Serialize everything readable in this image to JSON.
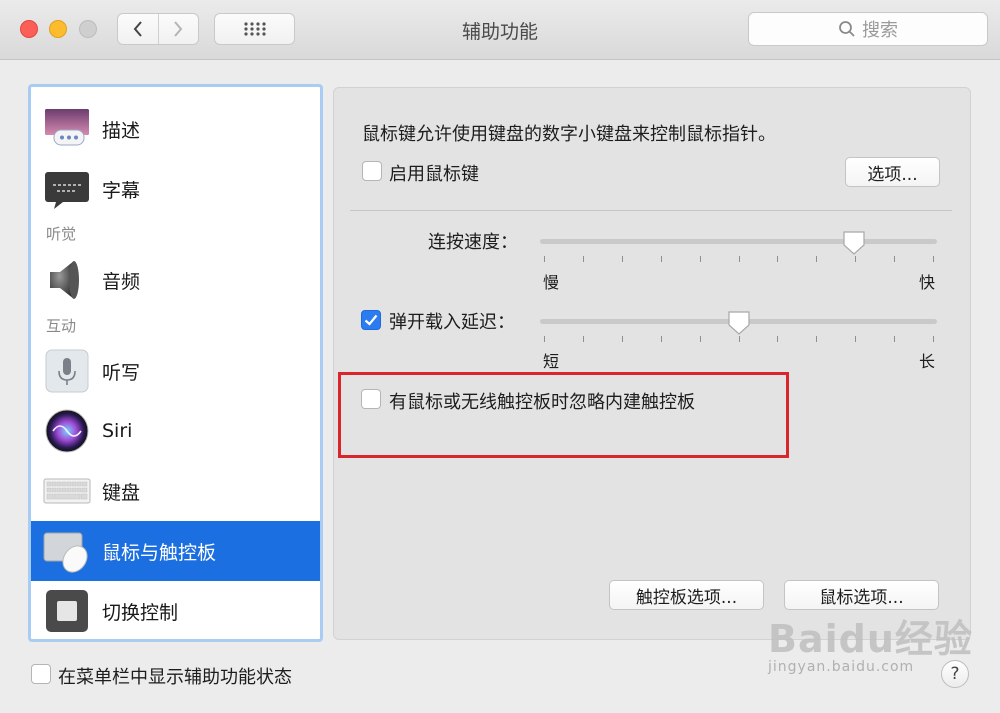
{
  "window": {
    "title": "辅助功能"
  },
  "search": {
    "placeholder": "搜索"
  },
  "sidebar": {
    "items": [
      {
        "label": "描述"
      },
      {
        "label": "字幕"
      },
      {
        "label": "音频"
      },
      {
        "label": "听写"
      },
      {
        "label": "Siri"
      },
      {
        "label": "键盘"
      },
      {
        "label": "鼠标与触控板",
        "selected": true
      },
      {
        "label": "切换控制"
      }
    ],
    "headers": {
      "hearing": "听觉",
      "interaction": "互动"
    }
  },
  "main": {
    "description": "鼠标键允许使用键盘的数字小键盘来控制鼠标指针。",
    "enable_mouse_keys": {
      "label": "启用鼠标键",
      "checked": false
    },
    "options_button": "选项...",
    "double_click_speed": {
      "label": "连按速度：",
      "min_label": "慢",
      "max_label": "快",
      "value": 0.79
    },
    "spring_loading": {
      "label": "弹开载入延迟：",
      "checked": true,
      "min_label": "短",
      "max_label": "长",
      "value": 0.5
    },
    "ignore_trackpad": {
      "label": "有鼠标或无线触控板时忽略内建触控板",
      "checked": false
    },
    "trackpad_options_button": "触控板选项...",
    "mouse_options_button": "鼠标选项..."
  },
  "footer": {
    "show_status": {
      "label": "在菜单栏中显示辅助功能状态",
      "checked": false
    },
    "help": "?"
  },
  "watermark": {
    "main": "Baidu经验",
    "sub": "jingyan.baidu.com"
  },
  "colors": {
    "accent": "#1c6fe0",
    "highlight_box": "#d9252b",
    "checkbox_checked": "#2a7cf0"
  }
}
